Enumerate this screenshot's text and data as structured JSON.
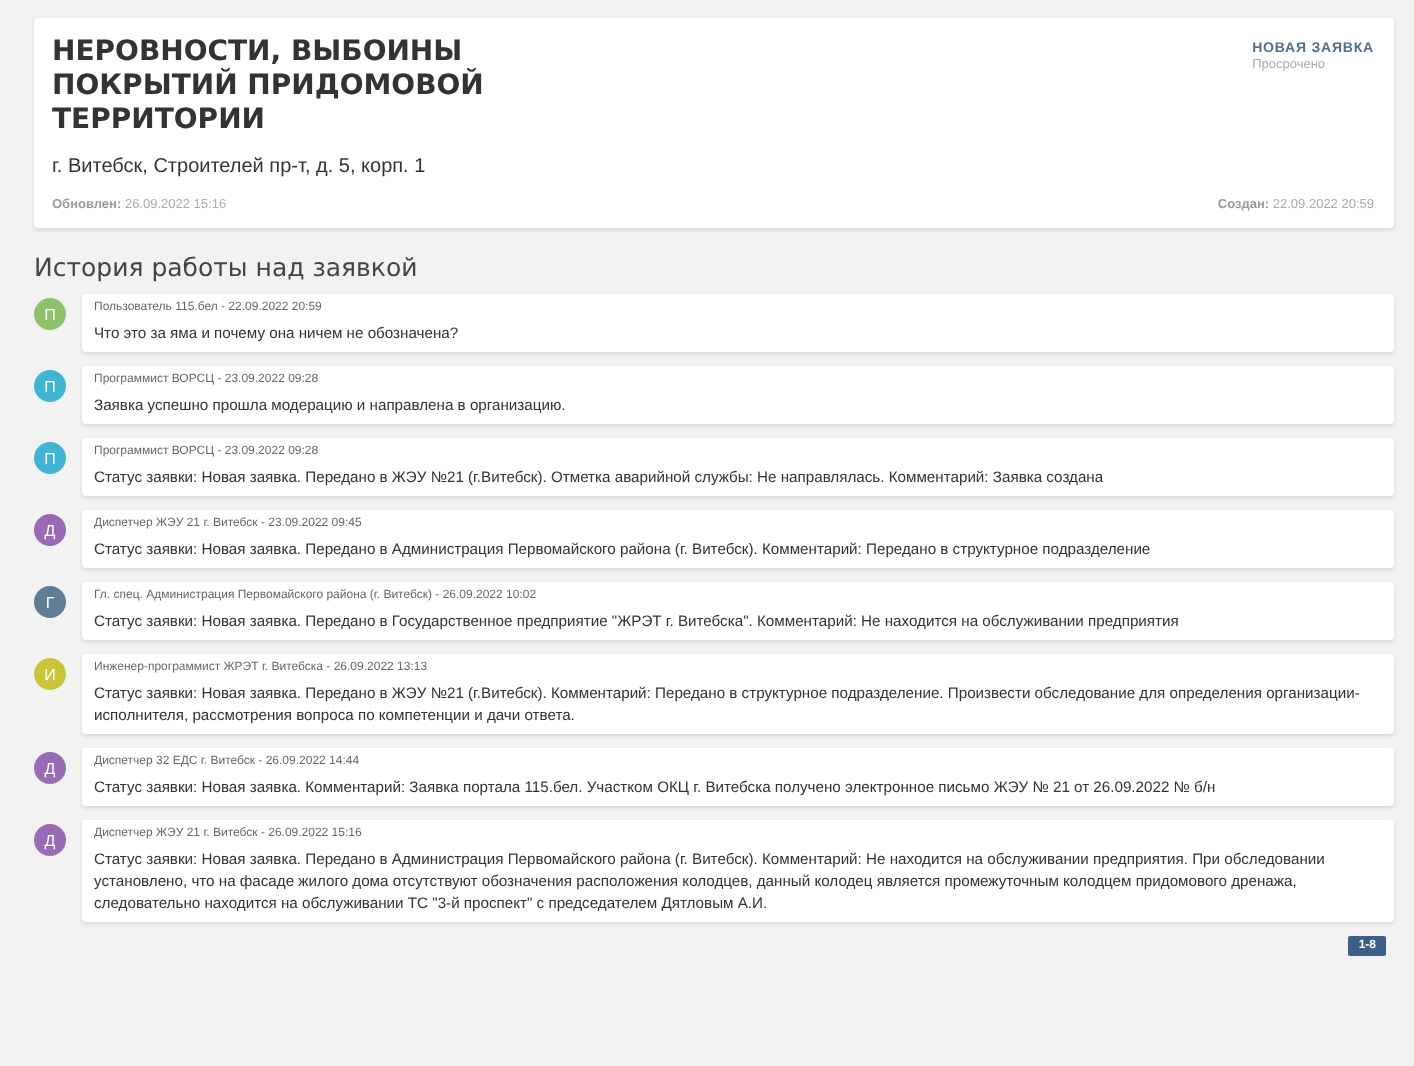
{
  "request": {
    "title": "НЕРОВНОСТИ, ВЫБОИНЫ ПОКРЫТИЙ ПРИДОМОВОЙ ТЕРРИТОРИИ",
    "address": "г. Витебск, Строителей пр-т, д. 5, корп. 1",
    "status": "НОВАЯ ЗАЯВКА",
    "status_note": "Просрочено",
    "updated_label": "Обновлен:",
    "updated": "26.09.2022 15:16",
    "created_label": "Создан:",
    "created": "22.09.2022 20:59"
  },
  "history": {
    "heading": "История работы над заявкой",
    "entries": [
      {
        "initial": "П",
        "color": "#8fc16a",
        "meta": "Пользователь 115.бел - 22.09.2022 20:59",
        "text": "Что это за яма и почему она ничем не обозначена?"
      },
      {
        "initial": "П",
        "color": "#3fb4d3",
        "meta": "Программист ВОРСЦ - 23.09.2022 09:28",
        "text": "Заявка успешно прошла модерацию и направлена в организацию."
      },
      {
        "initial": "П",
        "color": "#3fb4d3",
        "meta": "Программист ВОРСЦ - 23.09.2022 09:28",
        "text": "Статус заявки: Новая заявка. Передано в ЖЭУ №21 (г.Витебск). Отметка аварийной службы: Не направлялась. Комментарий: Заявка создана"
      },
      {
        "initial": "Д",
        "color": "#9a6bb5",
        "meta": "Диспетчер ЖЭУ 21 г. Витебск - 23.09.2022 09:45",
        "text": "Статус заявки: Новая заявка. Передано в Администрация Первомайского района (г. Витебск). Комментарий: Передано в структурное подразделение"
      },
      {
        "initial": "Г",
        "color": "#5f7e96",
        "meta": "Гл. спец. Администрация Первомайского района (г. Витебск) - 26.09.2022 10:02",
        "text": "Статус заявки: Новая заявка. Передано в Государственное предприятие \"ЖРЭТ г. Витебска\". Комментарий: Не находится на обслуживании предприятия"
      },
      {
        "initial": "И",
        "color": "#c9c43a",
        "meta": "Инженер-программист ЖРЭТ г. Витебска - 26.09.2022 13:13",
        "text": "Статус заявки: Новая заявка. Передано в ЖЭУ №21 (г.Витебск). Комментарий: Передано в структурное подразделение. Произвести обследование для определения организации-исполнителя, рассмотрения вопроса по компетенции и дачи ответа."
      },
      {
        "initial": "Д",
        "color": "#9a6bb5",
        "meta": "Диспетчер 32 ЕДС г. Витебск - 26.09.2022 14:44",
        "text": "Статус заявки: Новая заявка. Комментарий: Заявка портала 115.бел. Участком ОКЦ г. Витебска получено электронное письмо ЖЭУ № 21 от 26.09.2022 № б/н"
      },
      {
        "initial": "Д",
        "color": "#9a6bb5",
        "meta": "Диспетчер ЖЭУ 21 г. Витебск - 26.09.2022 15:16",
        "text": "Статус заявки: Новая заявка. Передано в Администрация Первомайского района (г. Витебск). Комментарий: Не находится на обслуживании предприятия. При обследовании установлено, что на фасаде жилого дома отсутствуют обозначения расположения колодцев, данный колодец является промежуточным колодцем придомового дренажа, следовательно находится на обслуживании ТС \"3-й проспект\" с председателем Дятловым А.И."
      }
    ]
  },
  "pager": {
    "label": "1-8"
  }
}
